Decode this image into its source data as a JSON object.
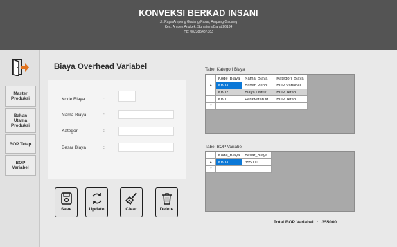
{
  "header": {
    "title": "KONVEKSI BERKAD INSANI",
    "address_line1": "Jl. Raya Ampeng Gadang Pasar, Ampang Gadang",
    "address_line2": "Kec. Ampek Angkek, Sumatera Barat 26134",
    "phone": "Hp: 082385487383"
  },
  "sidebar": {
    "items": [
      {
        "label": "Master\nProduksi"
      },
      {
        "label": "Bahan\nUtama\nProduksi"
      },
      {
        "label": "BOP Tetap"
      },
      {
        "label": "BOP\nVariabel"
      }
    ]
  },
  "form": {
    "title": "Biaya Overhead Variabel",
    "fields": [
      {
        "label": "Kode Biaya",
        "value": ""
      },
      {
        "label": "Nama Biaya",
        "value": ""
      },
      {
        "label": "Kategori",
        "value": ""
      },
      {
        "label": "Besar Biaya",
        "value": ""
      }
    ],
    "colon": ":"
  },
  "buttons": {
    "save": "Save",
    "update": "Update",
    "clear": "Clear",
    "delete": "Delete"
  },
  "kategori_table": {
    "caption": "Tabel Kategori Biaya",
    "columns": [
      "Kode_Biaya",
      "Nama_Biaya",
      "Kategori_Biaya"
    ],
    "rows": [
      [
        "KB03",
        "Bahan Penol...",
        "BOP Variabel"
      ],
      [
        "KB02",
        "Biaya Listrik",
        "BOP Tetap"
      ],
      [
        "KB01",
        "Perawatan M...",
        "BOP Tetap"
      ]
    ]
  },
  "bop_table": {
    "caption": "Tabel BOP Variabel",
    "columns": [
      "Kode_Biaya",
      "Besar_Biaya"
    ],
    "rows": [
      [
        "KB03",
        "355000"
      ]
    ]
  },
  "total": {
    "label": "Total BOP Variabel",
    "colon": ":",
    "value": "355000"
  },
  "row_marker": "▸",
  "new_row_marker": "*",
  "colors": {
    "header_bg": "#545454",
    "selection": "#0b78d7"
  }
}
